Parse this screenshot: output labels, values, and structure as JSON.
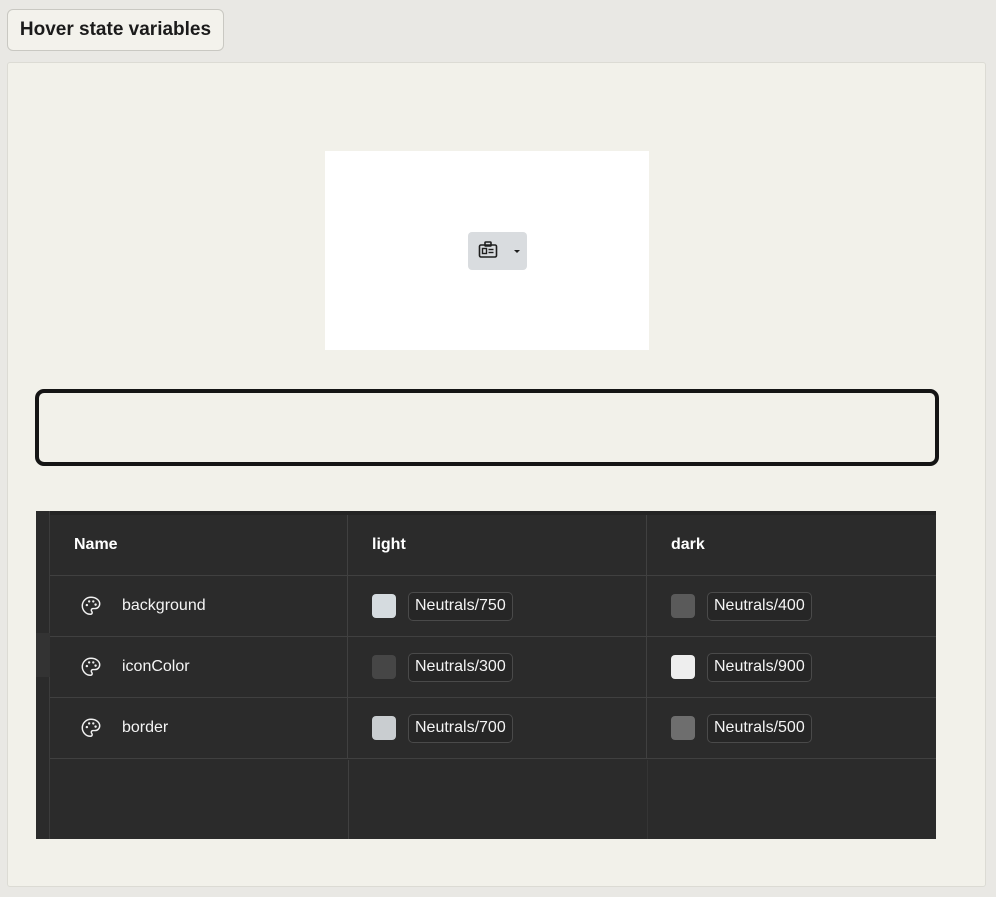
{
  "title_tab": {
    "label": "Hover state variables"
  },
  "preview": {
    "button_icon": "id-card-icon",
    "dropdown_icon": "caret-down-icon"
  },
  "table": {
    "columns": [
      "Name",
      "light",
      "dark"
    ],
    "rows": [
      {
        "icon": "palette-icon",
        "name": "background",
        "light": {
          "label": "Neutrals/750",
          "color": "#d5dbdf"
        },
        "dark": {
          "label": "Neutrals/400",
          "color": "#5a5a5a"
        }
      },
      {
        "icon": "palette-icon",
        "name": "iconColor",
        "light": {
          "label": "Neutrals/300",
          "color": "#464646"
        },
        "dark": {
          "label": "Neutrals/900",
          "color": "#eeeeee"
        }
      },
      {
        "icon": "palette-icon",
        "name": "border",
        "light": {
          "label": "Neutrals/700",
          "color": "#c9cdd0"
        },
        "dark": {
          "label": "Neutrals/500",
          "color": "#6e6e6e"
        }
      }
    ]
  }
}
